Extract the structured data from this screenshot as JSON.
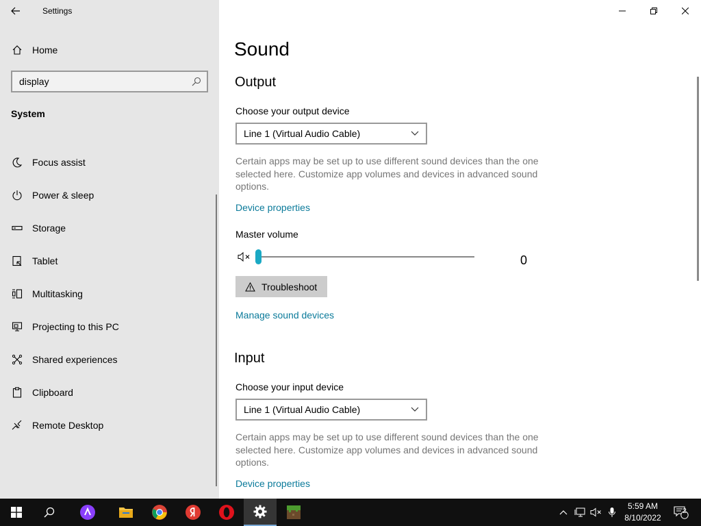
{
  "window": {
    "title": "Settings"
  },
  "sidebar": {
    "home_label": "Home",
    "search_value": "display",
    "section_title": "System",
    "items": [
      {
        "label": "Focus assist",
        "icon": "moon-icon"
      },
      {
        "label": "Power & sleep",
        "icon": "power-icon"
      },
      {
        "label": "Storage",
        "icon": "storage-icon"
      },
      {
        "label": "Tablet",
        "icon": "tablet-icon"
      },
      {
        "label": "Multitasking",
        "icon": "multitasking-icon"
      },
      {
        "label": "Projecting to this PC",
        "icon": "projecting-icon"
      },
      {
        "label": "Shared experiences",
        "icon": "shared-experiences-icon"
      },
      {
        "label": "Clipboard",
        "icon": "clipboard-icon"
      },
      {
        "label": "Remote Desktop",
        "icon": "remote-desktop-icon"
      }
    ]
  },
  "main": {
    "title": "Sound",
    "output": {
      "heading": "Output",
      "device_label": "Choose your output device",
      "device_value": "Line 1 (Virtual Audio Cable)",
      "description": "Certain apps may be set up to use different sound devices than the one selected here. Customize app volumes and devices in advanced sound options.",
      "properties_link": "Device properties",
      "volume_label": "Master volume",
      "volume_value": "0",
      "troubleshoot_label": "Troubleshoot",
      "manage_link": "Manage sound devices"
    },
    "input": {
      "heading": "Input",
      "device_label": "Choose your input device",
      "device_value": "Line 1 (Virtual Audio Cable)",
      "description": "Certain apps may be set up to use different sound devices than the one selected here. Customize app volumes and devices in advanced sound options.",
      "properties_link": "Device properties"
    }
  },
  "taskbar": {
    "time": "5:59 AM",
    "date": "8/10/2022",
    "notification_count": "2"
  },
  "colors": {
    "accent": "#1aa9c4",
    "link": "#0a7a9a",
    "sidebar_bg": "#e6e6e6",
    "taskbar_bg": "#101010"
  }
}
